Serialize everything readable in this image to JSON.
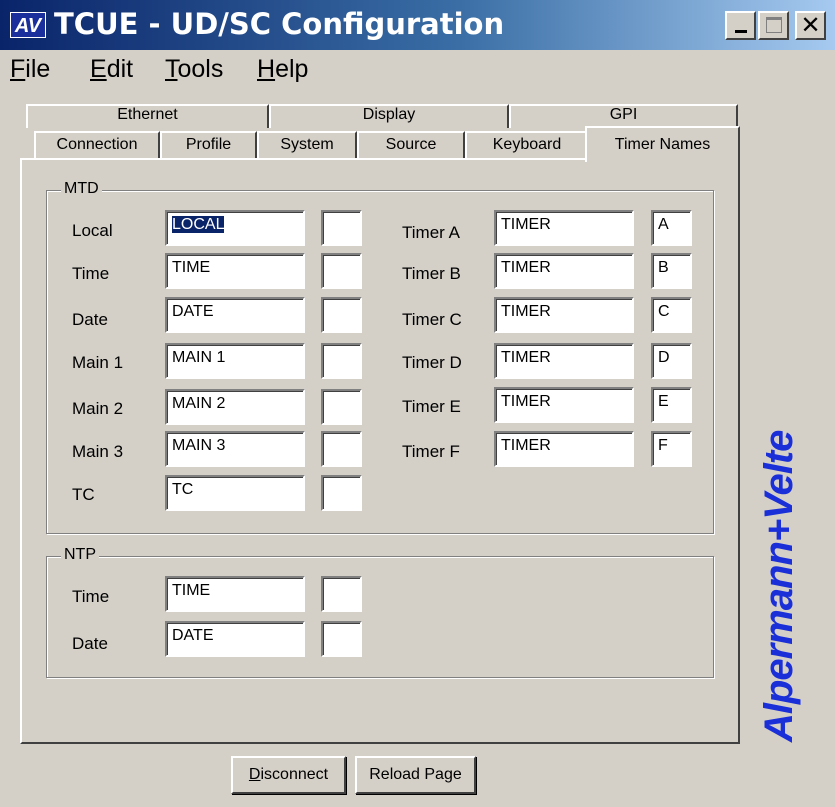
{
  "window": {
    "icon_text": "AV",
    "title": "TCUE - UD/SC Configuration",
    "close_glyph": "✕"
  },
  "menu": {
    "items": [
      {
        "first": "F",
        "rest": "ile"
      },
      {
        "first": "E",
        "rest": "dit"
      },
      {
        "first": "T",
        "rest": "ools"
      },
      {
        "first": "H",
        "rest": "elp"
      }
    ]
  },
  "tabs": {
    "back_row": [
      "Ethernet",
      "Display",
      "GPI"
    ],
    "front_row": [
      "Connection",
      "Profile",
      "System",
      "Source",
      "Keyboard",
      "Timer Names"
    ],
    "active": "Timer Names"
  },
  "mtd": {
    "title": "MTD",
    "left": [
      {
        "label": "Local",
        "value": "LOCAL",
        "code": ""
      },
      {
        "label": "Time",
        "value": "TIME",
        "code": ""
      },
      {
        "label": "Date",
        "value": "DATE",
        "code": ""
      },
      {
        "label": "Main 1",
        "value": "MAIN 1",
        "code": ""
      },
      {
        "label": "Main 2",
        "value": "MAIN 2",
        "code": ""
      },
      {
        "label": "Main 3",
        "value": "MAIN 3",
        "code": ""
      },
      {
        "label": "TC",
        "value": "TC",
        "code": ""
      }
    ],
    "right": [
      {
        "label": "Timer A",
        "value": "TIMER",
        "code": "A"
      },
      {
        "label": "Timer B",
        "value": "TIMER",
        "code": "B"
      },
      {
        "label": "Timer C",
        "value": "TIMER",
        "code": "C"
      },
      {
        "label": "Timer D",
        "value": "TIMER",
        "code": "D"
      },
      {
        "label": "Timer E",
        "value": "TIMER",
        "code": "E"
      },
      {
        "label": "Timer F",
        "value": "TIMER",
        "code": "F"
      }
    ]
  },
  "ntp": {
    "title": "NTP",
    "rows": [
      {
        "label": "Time",
        "value": "TIME",
        "code": ""
      },
      {
        "label": "Date",
        "value": "DATE",
        "code": ""
      }
    ]
  },
  "brand": "Alpermann+Velte",
  "buttons": {
    "disconnect_first": "D",
    "disconnect_rest": "isconnect",
    "reload": "Reload Page"
  },
  "colors": {
    "brand": "#1a2fd8",
    "titlebar_start": "#0a246a",
    "titlebar_end": "#a6caf0",
    "selection": "#0a246a"
  }
}
